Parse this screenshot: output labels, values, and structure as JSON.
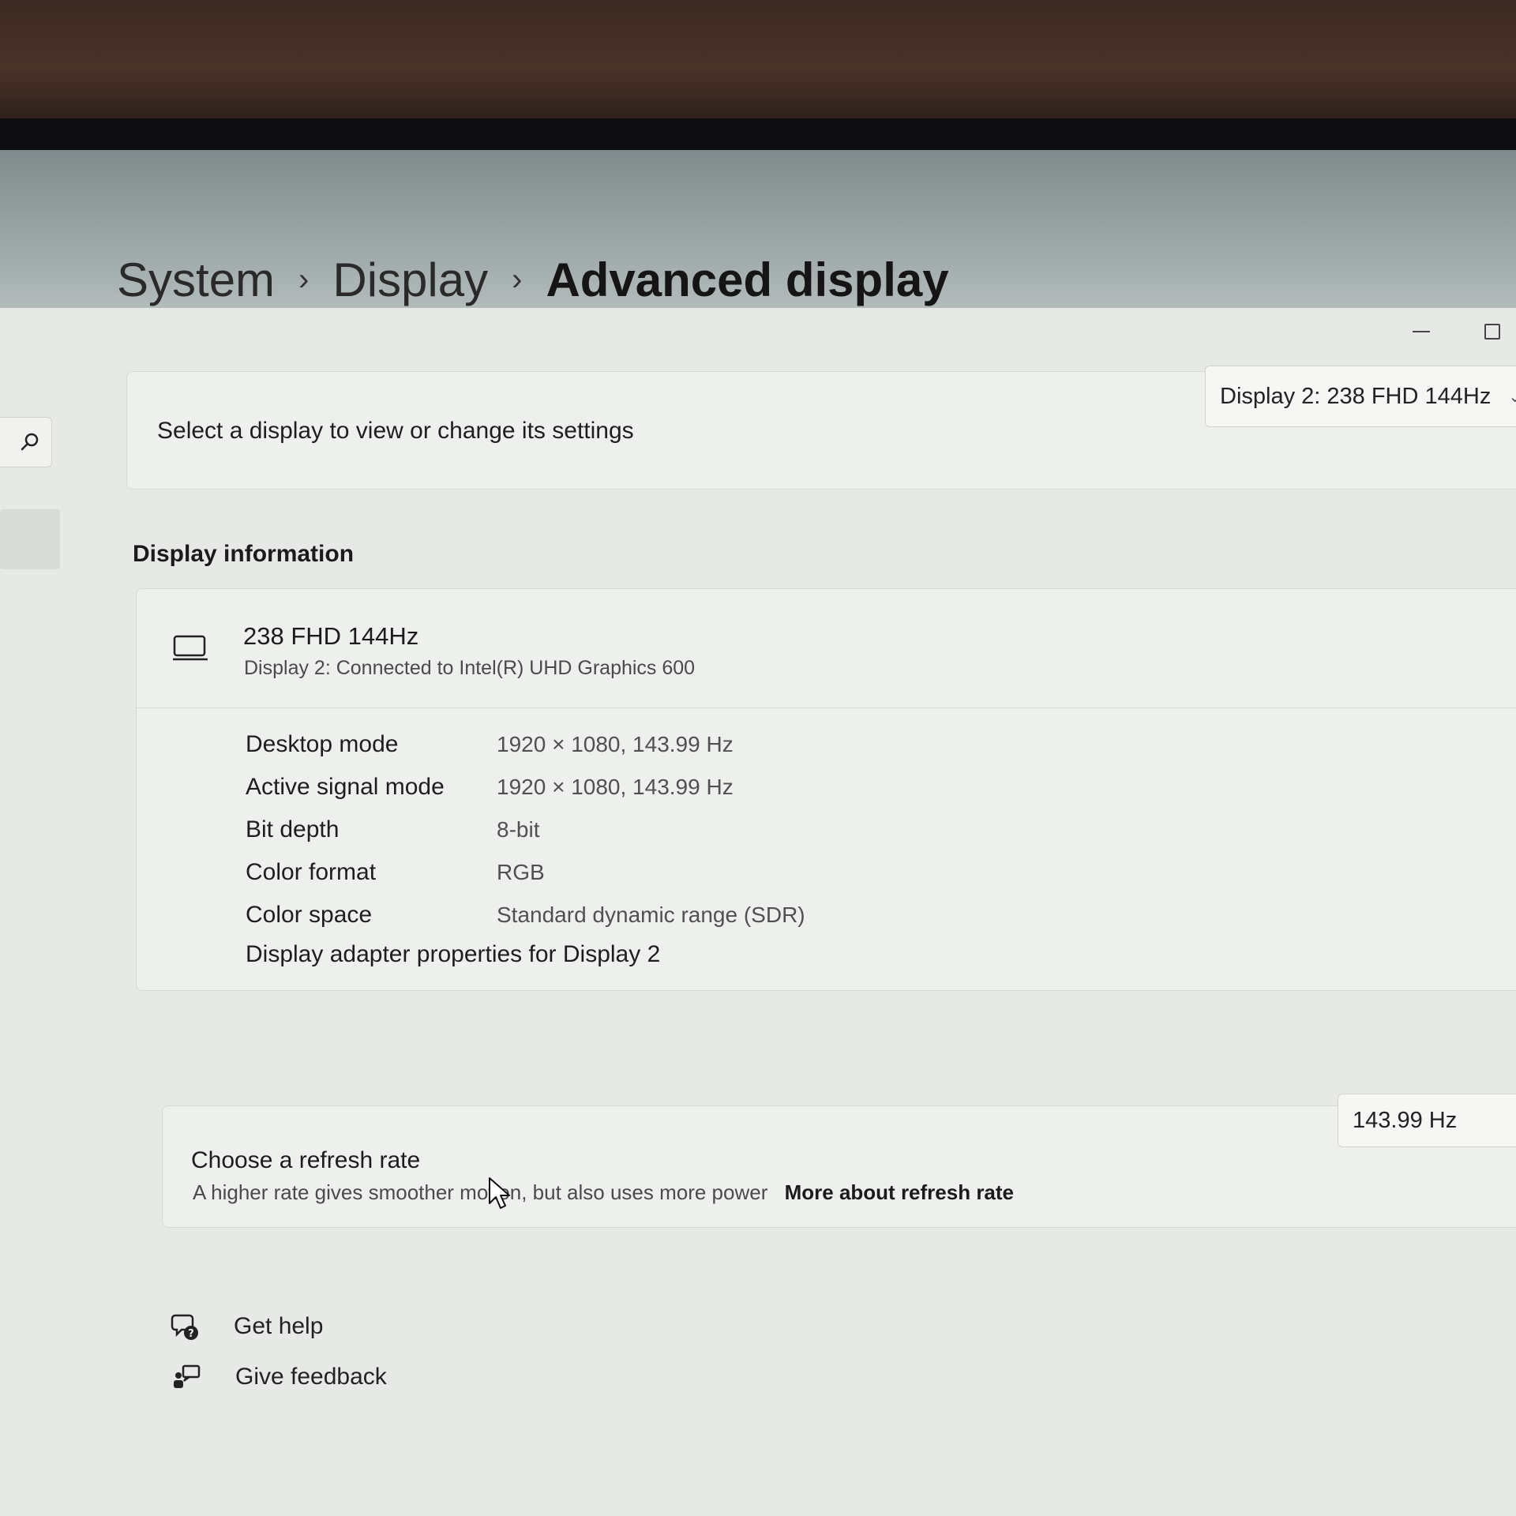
{
  "breadcrumb": {
    "items": [
      "System",
      "Display"
    ],
    "current": "Advanced display",
    "separator": "›"
  },
  "display_selector": {
    "label": "Select a display to view or change its settings",
    "selected": "Display 2: 238 FHD 144Hz"
  },
  "display_info": {
    "heading": "Display information",
    "monitor_name": "238 FHD 144Hz",
    "monitor_subtitle": "Display 2: Connected to Intel(R) UHD Graphics 600",
    "rows": [
      {
        "label": "Desktop mode",
        "value": "1920 × 1080, 143.99 Hz"
      },
      {
        "label": "Active signal mode",
        "value": "1920 × 1080, 143.99 Hz"
      },
      {
        "label": "Bit depth",
        "value": "8-bit"
      },
      {
        "label": "Color format",
        "value": "RGB"
      },
      {
        "label": "Color space",
        "value": "Standard dynamic range (SDR)"
      }
    ],
    "adapter_link": "Display adapter properties for Display 2"
  },
  "refresh_rate": {
    "title": "Choose a refresh rate",
    "description": "A higher rate gives smoother motion, but also uses more power",
    "link": "More about refresh rate",
    "selected": "143.99 Hz"
  },
  "footer": {
    "get_help": "Get help",
    "give_feedback": "Give feedback"
  },
  "icons": {
    "search": "search-icon",
    "monitor": "monitor-icon",
    "help": "help-icon",
    "feedback": "feedback-icon",
    "chevron": "chevron-down-icon"
  },
  "colors": {
    "window_bg": "#e7e9e6",
    "card_bg": "#eef0ed",
    "text_primary": "#1c1c1c",
    "text_secondary": "#4a4a4a"
  }
}
